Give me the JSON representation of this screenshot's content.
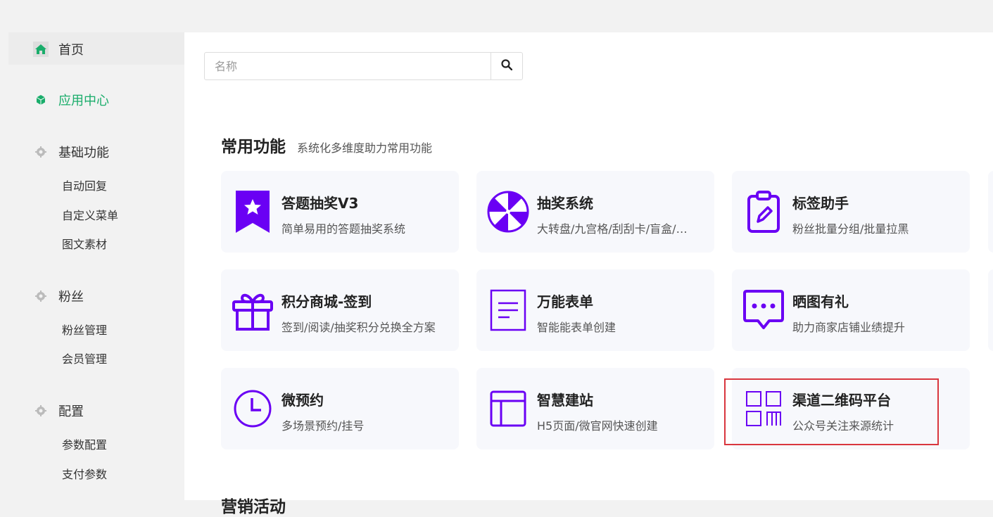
{
  "sidebar": {
    "home": {
      "label": "首页",
      "icon": "home-icon"
    },
    "app_center": {
      "label": "应用中心",
      "icon": "cube-icon"
    },
    "groups": [
      {
        "label": "基础功能",
        "icon": "gear-icon",
        "items": [
          "自动回复",
          "自定义菜单",
          "图文素材"
        ]
      },
      {
        "label": "粉丝",
        "icon": "gear-icon",
        "items": [
          "粉丝管理",
          "会员管理"
        ]
      },
      {
        "label": "配置",
        "icon": "gear-icon",
        "items": [
          "参数配置",
          "支付参数"
        ]
      }
    ]
  },
  "search": {
    "placeholder": "名称",
    "value": "",
    "icon": "search-icon"
  },
  "section": {
    "title": "常用功能",
    "subtitle": "系统化多维度助力常用功能"
  },
  "cards": [
    {
      "title": "答题抽奖V3",
      "desc": "简单易用的答题抽奖系统",
      "icon": "star-ribbon-icon"
    },
    {
      "title": "抽奖系统",
      "desc": "大转盘/九宫格/刮刮卡/盲盒/…",
      "icon": "wheel-icon"
    },
    {
      "title": "标签助手",
      "desc": "粉丝批量分组/批量拉黑",
      "icon": "tag-clipboard-icon"
    },
    {
      "title": "积分商城-签到",
      "desc": "签到/阅读/抽奖积分兑换全方案",
      "icon": "gift-icon"
    },
    {
      "title": "万能表单",
      "desc": "智能能表单创建",
      "icon": "form-icon"
    },
    {
      "title": "晒图有礼",
      "desc": "助力商家店铺业绩提升",
      "icon": "chat-bubble-icon"
    },
    {
      "title": "微预约",
      "desc": "多场景预约/挂号",
      "icon": "clock-icon"
    },
    {
      "title": "智慧建站",
      "desc": "H5页面/微官网快速创建",
      "icon": "layout-icon"
    },
    {
      "title": "渠道二维码平台",
      "desc": "公众号关注来源统计",
      "icon": "qrcode-icon"
    }
  ],
  "next_section": {
    "title": "营销活动"
  },
  "colors": {
    "accent_green": "#1aad6b",
    "icon_purple": "#6a00f4",
    "highlight_red": "#d9363e"
  }
}
